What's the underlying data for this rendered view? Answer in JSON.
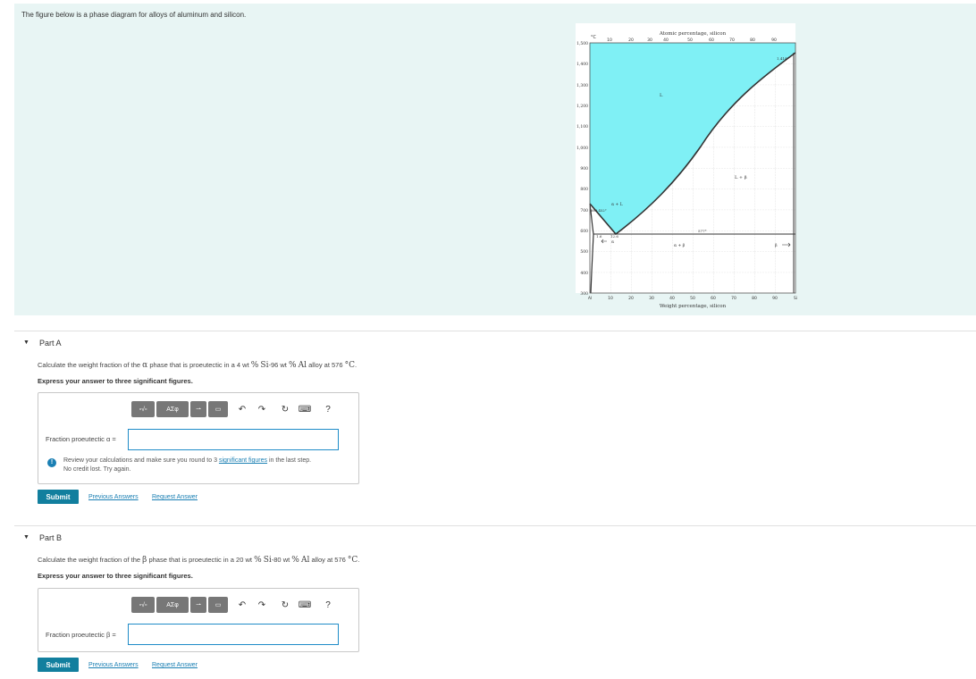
{
  "intro": {
    "text": "The figure below is a phase diagram for alloys of aluminum and silicon."
  },
  "diagram": {
    "top_axis_label": "Atomic percentage, silicon",
    "bottom_axis_label": "Weight percentage, silicon",
    "y_unit": "°C",
    "top_ticks": [
      "10",
      "20",
      "30",
      "40",
      "50",
      "60",
      "70",
      "80",
      "90"
    ],
    "bottom_ticks": [
      "10",
      "20",
      "30",
      "40",
      "50",
      "60",
      "70",
      "80",
      "90"
    ],
    "left_end": "Al",
    "right_end": "Si",
    "y_ticks": [
      "1,500",
      "1,400",
      "1,300",
      "1,200",
      "1,100",
      "1,000",
      "900",
      "800",
      "700",
      "600",
      "500",
      "400",
      "300"
    ],
    "labels": {
      "liquid": "L",
      "alpha_l": "α + L",
      "l_beta": "L + β",
      "alpha_beta": "α + β",
      "beta": "β",
      "alpha": "α",
      "al_melt": "660.452°",
      "si_melt": "1,414°",
      "eutectic_temp": "577°",
      "alpha_comp": "1.6",
      "eutectic_comp": "12.6"
    },
    "fill_color": "#7ff0f5"
  },
  "partA": {
    "title": "Part A",
    "q_before": "Calculate the weight fraction of the",
    "q_greek": "α",
    "q_mid": "phase that is proeutectic in a 4 wt",
    "q_pct1": "%",
    "q_si": "Si",
    "q_mid2": "-96 wt",
    "q_pct2": "%",
    "q_al": "Al",
    "q_after": "alloy at 576",
    "q_unit": "°C",
    "q_end": ".",
    "instruction": "Express your answer to three significant figures.",
    "answer_label": "Fraction proeutectic α =",
    "answer_value": "",
    "feedback_1": "Review your calculations and make sure you round to 3",
    "feedback_link": "significant figures",
    "feedback_2": "in the last step.",
    "feedback_3": "No credit lost. Try again.",
    "submit": "Submit",
    "prev": "Previous Answers",
    "request": "Request Answer"
  },
  "partB": {
    "title": "Part B",
    "q_before": "Calculate the weight fraction of the",
    "q_greek": "β",
    "q_mid": "phase that is proeutectic in a 20 wt",
    "q_pct1": "%",
    "q_si": "Si",
    "q_mid2": "-80 wt",
    "q_pct2": "%",
    "q_al": "Al",
    "q_after": "alloy at 576",
    "q_unit": "°C",
    "q_end": ".",
    "instruction": "Express your answer to three significant figures.",
    "answer_label": "Fraction proeutectic β =",
    "answer_value": "",
    "submit": "Submit",
    "prev": "Previous Answers",
    "request": "Request Answer"
  },
  "toolbar": {
    "undo_icon": "↶",
    "redo_icon": "↷",
    "reset_icon": "↻",
    "keyboard_icon": "⌨",
    "help_icon": "?"
  }
}
